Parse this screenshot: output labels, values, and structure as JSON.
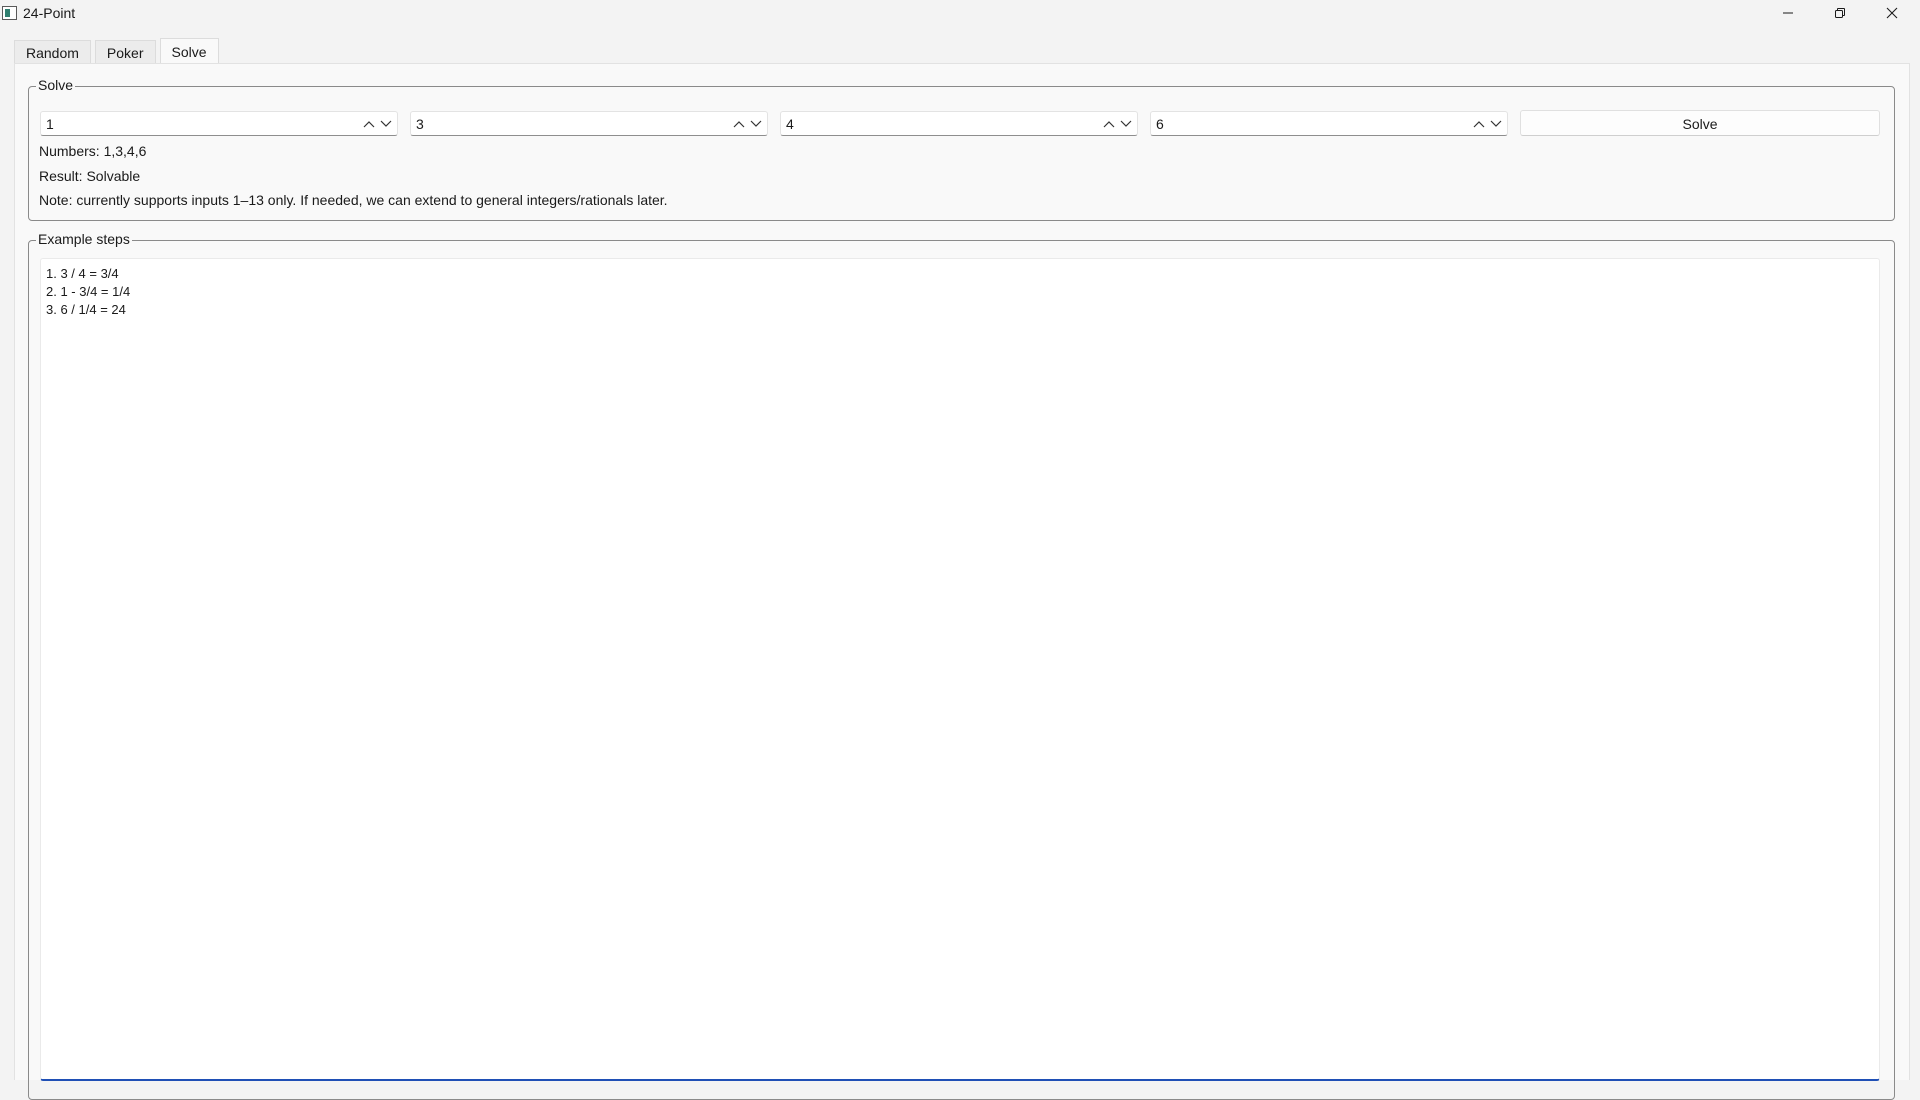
{
  "window": {
    "title": "24-Point",
    "icons": {
      "app": "app-window-icon",
      "minimize": "minimize-icon",
      "maximize": "restore-icon",
      "close": "close-icon"
    }
  },
  "tabs": [
    {
      "label": "Random",
      "active": false
    },
    {
      "label": "Poker",
      "active": false
    },
    {
      "label": "Solve",
      "active": true
    }
  ],
  "solve_group": {
    "title": "Solve",
    "inputs": [
      "1",
      "3",
      "4",
      "6"
    ],
    "input_range": [
      1,
      13
    ],
    "solve_label": "Solve",
    "numbers_text": "Numbers: 1,3,4,6",
    "result_text": "Result: Solvable",
    "note_text": "Note: currently supports inputs 1–13 only. If needed, we can extend to general integers/rationals later."
  },
  "steps_group": {
    "title": "Example steps",
    "lines": [
      "1. 3 / 4 = 3/4",
      "2. 1 - 3/4 = 1/4",
      "3. 6 / 1/4 = 24"
    ]
  },
  "colors": {
    "window_bg": "#f3f3f3",
    "pane_bg": "#f9f9f9",
    "focus_accent": "#1f4fb5",
    "group_border": "#8a8a8a"
  }
}
